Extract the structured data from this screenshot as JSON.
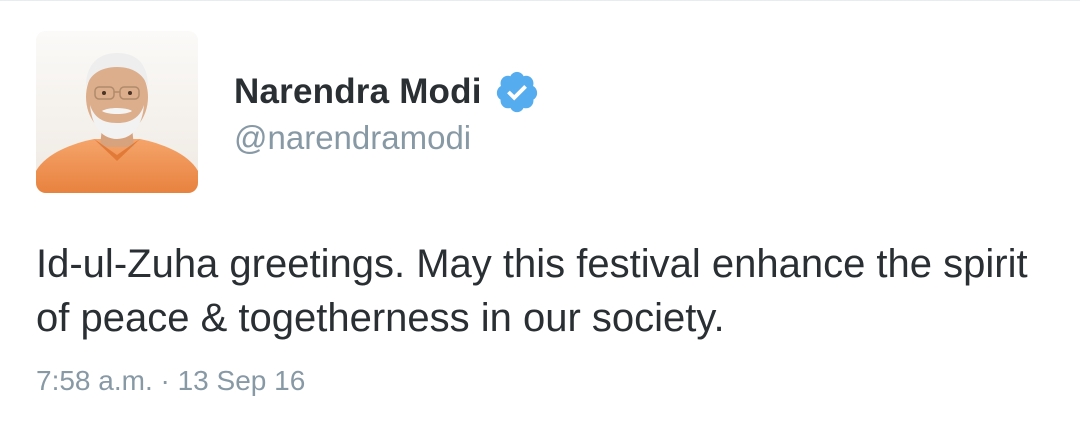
{
  "tweet": {
    "author": {
      "display_name": "Narendra Modi",
      "handle": "@narendramodi",
      "verified": true,
      "avatar_icon": "profile-photo"
    },
    "text": "Id-ul-Zuha greetings. May this festival enhance the spirit of peace & togetherness in our society.",
    "timestamp": "7:58 a.m. · 13 Sep 16"
  },
  "colors": {
    "name": "#292f33",
    "handle": "#8899a6",
    "verified_badge": "#55acee",
    "text": "#292f33",
    "timestamp": "#8899a6"
  }
}
